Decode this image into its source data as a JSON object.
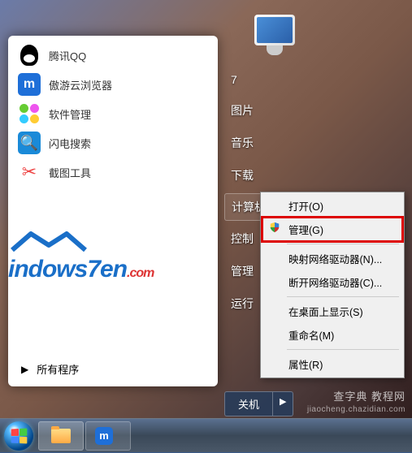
{
  "desktop": {
    "computer_icon_name": "computer-icon"
  },
  "start_menu": {
    "pinned": [
      {
        "label": "腾讯QQ",
        "icon": "qq-icon"
      },
      {
        "label": "傲游云浏览器",
        "icon": "maxthon-icon"
      },
      {
        "label": "软件管理",
        "icon": "software-mgr-icon"
      },
      {
        "label": "闪电搜索",
        "icon": "flash-search-icon"
      },
      {
        "label": "截图工具",
        "icon": "scissors-icon"
      },
      {
        "label": "",
        "icon": "blank-icon"
      }
    ],
    "all_programs_label": "所有程序",
    "right_items": [
      {
        "label": "7",
        "type": "plain"
      },
      {
        "label": "图片",
        "type": "plain"
      },
      {
        "label": "音乐",
        "type": "plain"
      },
      {
        "label": "下载",
        "type": "plain"
      },
      {
        "label": "计算机",
        "type": "boxed"
      },
      {
        "label": "控制",
        "type": "plain"
      },
      {
        "label": "管理",
        "type": "plain"
      },
      {
        "label": "运行",
        "type": "plain"
      }
    ],
    "shutdown_label": "关机"
  },
  "context_menu": {
    "items": [
      {
        "label": "打开(O)",
        "icon": null,
        "highlight": false
      },
      {
        "label": "管理(G)",
        "icon": "shield",
        "highlight": true
      },
      {
        "label": "映射网络驱动器(N)...",
        "icon": null,
        "highlight": false
      },
      {
        "label": "断开网络驱动器(C)...",
        "icon": null,
        "highlight": false
      },
      {
        "label": "在桌面上显示(S)",
        "icon": null,
        "highlight": false
      },
      {
        "label": "重命名(M)",
        "icon": null,
        "highlight": false
      },
      {
        "label": "属性(R)",
        "icon": null,
        "highlight": false
      }
    ]
  },
  "watermark": {
    "main": "查字典 教程网",
    "sub": "jiaocheng.chazidian.com"
  },
  "logo": {
    "text": "indows7en",
    "suffix": ".com"
  }
}
